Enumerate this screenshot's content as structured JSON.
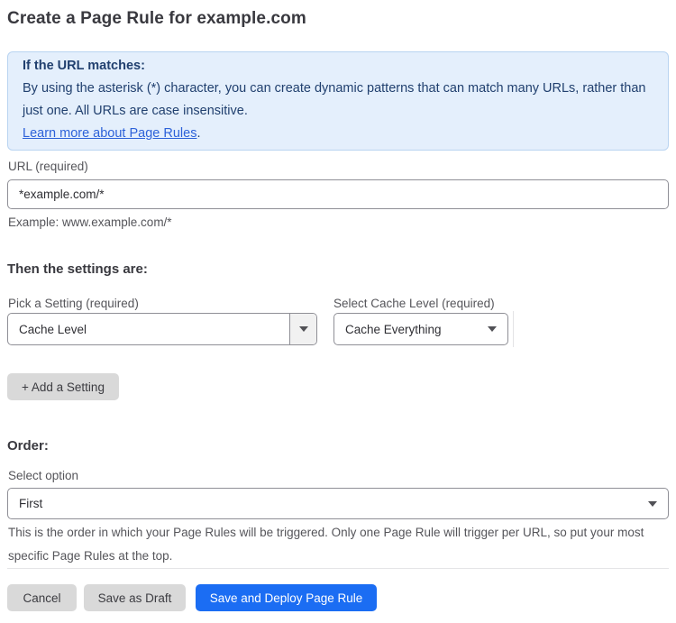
{
  "page": {
    "title": "Create a Page Rule for example.com"
  },
  "info_box": {
    "heading": "If the URL matches:",
    "body": "By using the asterisk (*) character, you can create dynamic patterns that can match many URLs, rather than just one. All URLs are case insensitive.",
    "link": "Learn more about Page Rules",
    "link_suffix": "."
  },
  "url_field": {
    "label": "URL (required)",
    "value": "*example.com/*",
    "example": "Example: www.example.com/*"
  },
  "settings": {
    "heading": "Then the settings are:",
    "setting_label": "Pick a Setting (required)",
    "setting_value": "Cache Level",
    "cache_label": "Select Cache Level (required)",
    "cache_value": "Cache Everything",
    "add_button": "+ Add a Setting"
  },
  "order": {
    "heading": "Order:",
    "label": "Select option",
    "value": "First",
    "help": "This is the order in which your Page Rules will be triggered. Only one Page Rule will trigger per URL, so put your most specific Page Rules at the top."
  },
  "footer": {
    "cancel": "Cancel",
    "save_draft": "Save as Draft",
    "save_deploy": "Save and Deploy Page Rule"
  },
  "colors": {
    "accent_blue": "#1b6df3",
    "info_bg": "#e4effc",
    "info_border": "#b9d4f1",
    "info_text": "#21406f",
    "link_blue": "#2d62d9",
    "button_gray": "#d9d9d9",
    "input_border": "#8f8f96"
  }
}
